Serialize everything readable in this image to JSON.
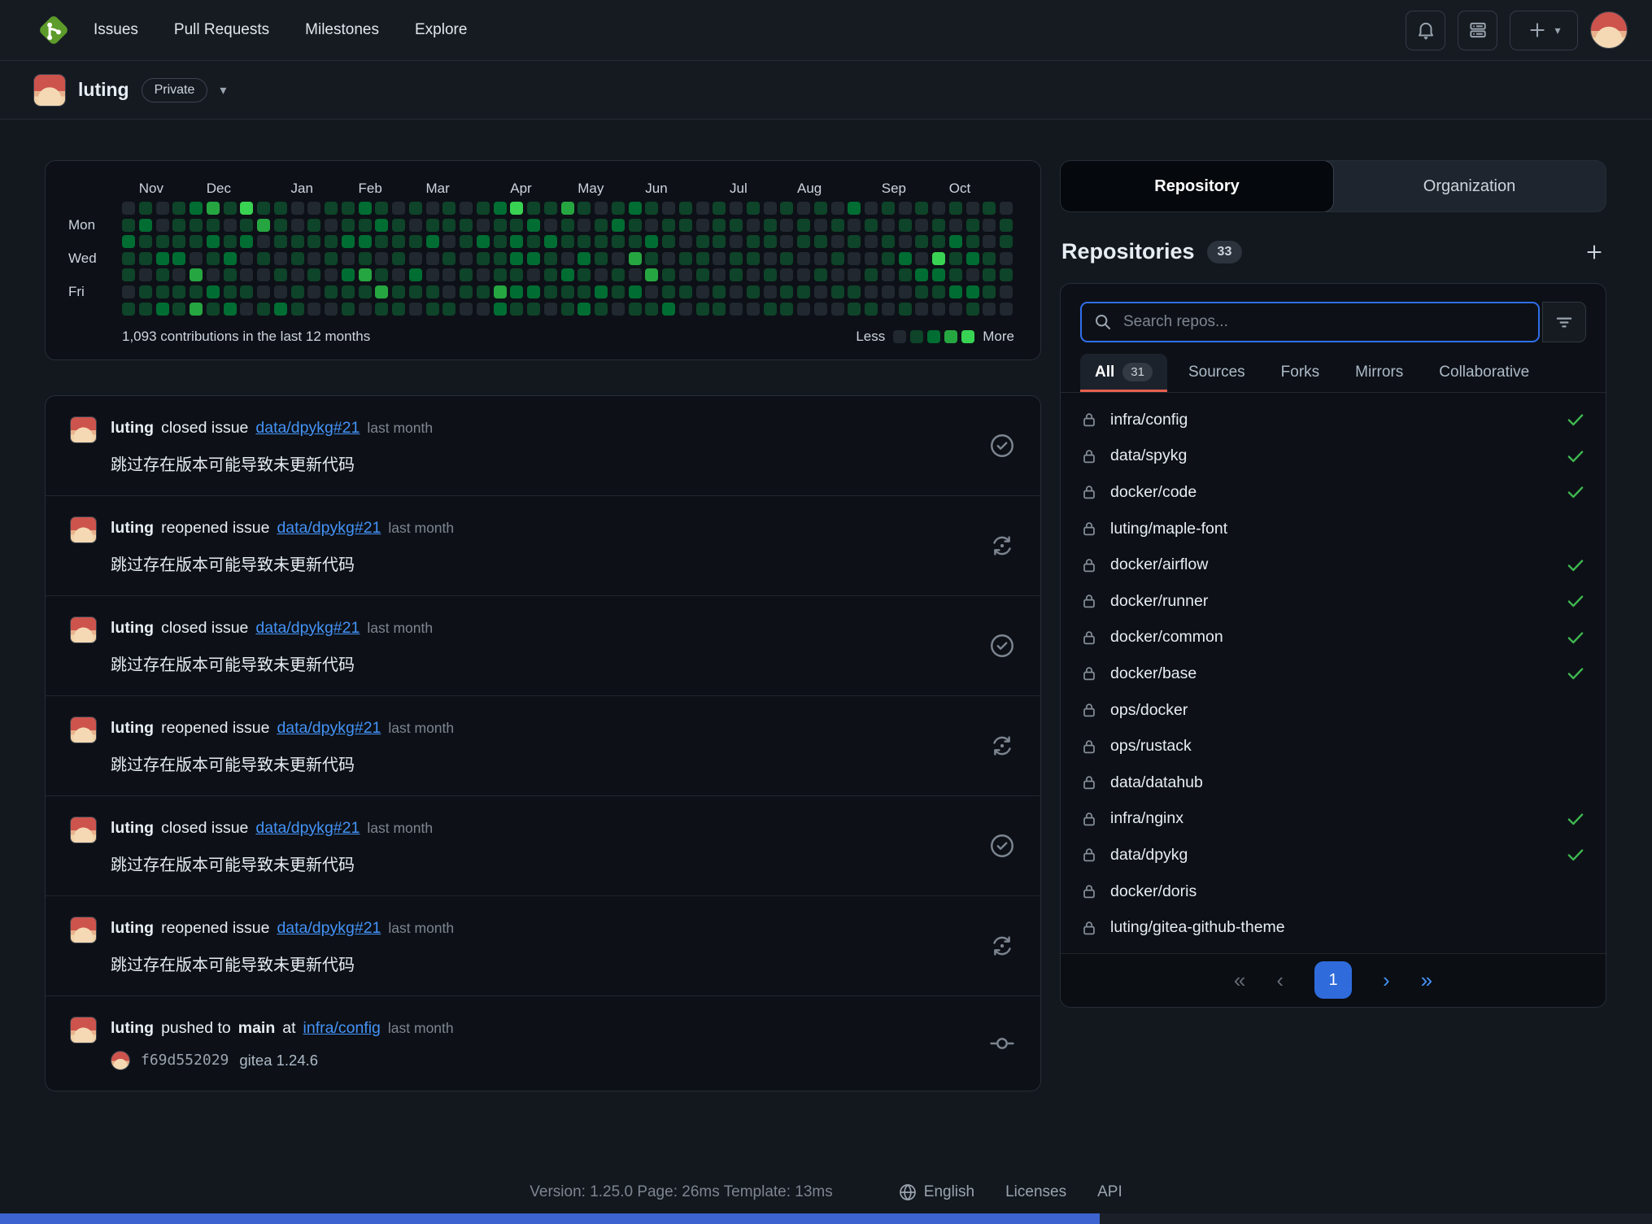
{
  "colors": {
    "link_blue": "#4493f8",
    "check_green": "#3fb950",
    "tab_underline": "#e5604e",
    "pager_active": "#2f6bdb",
    "search_focus_border": "#2f6feb"
  },
  "navbar": {
    "links": [
      "Issues",
      "Pull Requests",
      "Milestones",
      "Explore"
    ],
    "icons": [
      "gitea-logo-icon",
      "bell-icon",
      "server-icon",
      "plus-icon",
      "caret-down-icon",
      "avatar"
    ]
  },
  "profile": {
    "username": "luting",
    "badge": "Private"
  },
  "heatmap": {
    "summary": "1,093 contributions in the last 12 months",
    "less": "Less",
    "more": "More",
    "day_labels": [
      "Mon",
      "Wed",
      "Fri"
    ],
    "months": [
      {
        "label": "Nov",
        "week": 1
      },
      {
        "label": "Dec",
        "week": 5
      },
      {
        "label": "Jan",
        "week": 10
      },
      {
        "label": "Feb",
        "week": 14
      },
      {
        "label": "Mar",
        "week": 18
      },
      {
        "label": "Apr",
        "week": 23
      },
      {
        "label": "May",
        "week": 27
      },
      {
        "label": "Jun",
        "week": 31
      },
      {
        "label": "Jul",
        "week": 36
      },
      {
        "label": "Aug",
        "week": 40
      },
      {
        "label": "Sep",
        "week": 45
      },
      {
        "label": "Oct",
        "week": 49
      }
    ],
    "palette": [
      "#212830",
      "#0e4429",
      "#006d32",
      "#26a641",
      "#39d353"
    ],
    "weeks": [
      "0121101",
      "1211011",
      "0012112",
      "1112011",
      "2110313",
      "3121021",
      "1012112",
      "4120010",
      "1301001",
      "1110102",
      "0011011",
      "0110100",
      "1011010",
      "1120211",
      "2121310",
      "1210131",
      "0111011",
      "1010210",
      "0120011",
      "1101001",
      "0110110",
      "1021010",
      "2111132",
      "4122121",
      "1212021",
      "1021110",
      "3110211",
      "1012112",
      "0111021",
      "1210110",
      "2113021",
      "1021301",
      "0110112",
      "1101010",
      "0011101",
      "1110011",
      "0101100",
      "1011010",
      "0110101",
      "1001011",
      "0110010",
      "1010100",
      "0101010",
      "2010011",
      "0100101",
      "1011000",
      "0102101",
      "1010210",
      "0114210",
      "1021120",
      "0112021",
      "1001110",
      "0110100"
    ]
  },
  "feed": {
    "items": [
      {
        "actor": "luting",
        "action": "closed issue",
        "target": "data/dpykg#21",
        "time": "last month",
        "body": "跳过存在版本可能导致未更新代码",
        "icon": "issue-closed"
      },
      {
        "actor": "luting",
        "action": "reopened issue",
        "target": "data/dpykg#21",
        "time": "last month",
        "body": "跳过存在版本可能导致未更新代码",
        "icon": "issue-reopened"
      },
      {
        "actor": "luting",
        "action": "closed issue",
        "target": "data/dpykg#21",
        "time": "last month",
        "body": "跳过存在版本可能导致未更新代码",
        "icon": "issue-closed"
      },
      {
        "actor": "luting",
        "action": "reopened issue",
        "target": "data/dpykg#21",
        "time": "last month",
        "body": "跳过存在版本可能导致未更新代码",
        "icon": "issue-reopened"
      },
      {
        "actor": "luting",
        "action": "closed issue",
        "target": "data/dpykg#21",
        "time": "last month",
        "body": "跳过存在版本可能导致未更新代码",
        "icon": "issue-closed"
      },
      {
        "actor": "luting",
        "action": "reopened issue",
        "target": "data/dpykg#21",
        "time": "last month",
        "body": "跳过存在版本可能导致未更新代码",
        "icon": "issue-reopened"
      },
      {
        "actor": "luting",
        "action": "pushed to",
        "branch": "main",
        "action2": "at",
        "target": "infra/config",
        "time": "last month",
        "commit": {
          "hash": "f69d552029",
          "message": "gitea 1.24.6"
        },
        "icon": "commit"
      }
    ]
  },
  "sidebar": {
    "seg_tabs": [
      {
        "label": "Repository",
        "active": true
      },
      {
        "label": "Organization",
        "active": false
      }
    ],
    "heading": "Repositories",
    "count": "33",
    "search_placeholder": "Search repos...",
    "filter_tabs": [
      {
        "label": "All",
        "count": "31",
        "active": true
      },
      {
        "label": "Sources"
      },
      {
        "label": "Forks"
      },
      {
        "label": "Mirrors"
      },
      {
        "label": "Collaborative"
      }
    ],
    "repos": [
      {
        "name": "infra/config",
        "check": true
      },
      {
        "name": "data/spykg",
        "check": true
      },
      {
        "name": "docker/code",
        "check": true
      },
      {
        "name": "luting/maple-font",
        "check": false
      },
      {
        "name": "docker/airflow",
        "check": true
      },
      {
        "name": "docker/runner",
        "check": true
      },
      {
        "name": "docker/common",
        "check": true
      },
      {
        "name": "docker/base",
        "check": true
      },
      {
        "name": "ops/docker",
        "check": false
      },
      {
        "name": "ops/rustack",
        "check": false
      },
      {
        "name": "data/datahub",
        "check": false
      },
      {
        "name": "infra/nginx",
        "check": true
      },
      {
        "name": "data/dpykg",
        "check": true
      },
      {
        "name": "docker/doris",
        "check": false
      },
      {
        "name": "luting/gitea-github-theme",
        "check": false
      }
    ],
    "pagination": {
      "first": "«",
      "prev": "‹",
      "current": "1",
      "next": "›",
      "last": "»"
    }
  },
  "footer": {
    "version": "Version: 1.25.0 Page: 26ms Template: 13ms",
    "language": "English",
    "links": [
      "Licenses",
      "API"
    ]
  }
}
